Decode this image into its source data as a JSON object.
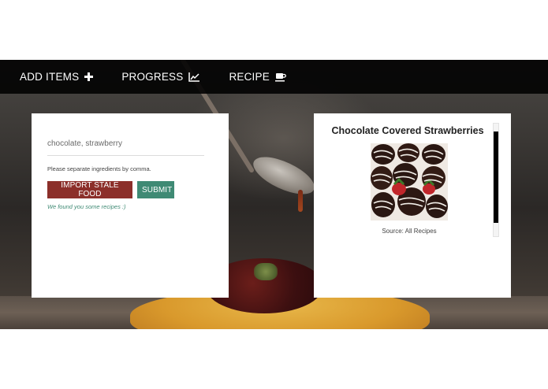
{
  "nav": {
    "items": [
      {
        "label": "ADD ITEMS",
        "icon": "plus-icon"
      },
      {
        "label": "PROGRESS",
        "icon": "line-chart-icon"
      },
      {
        "label": "RECIPE",
        "icon": "coffee-cup-icon"
      }
    ]
  },
  "form": {
    "ingredients_value": "chocolate, strawberry",
    "hint": "Please separate ingredients by comma.",
    "import_label": "IMPORT STALE FOOD",
    "submit_label": "SUBMIT",
    "result_message": "We found you some recipes :)"
  },
  "recipe": {
    "title": "Chocolate Covered Strawberries",
    "source": "Source: All Recipes"
  },
  "colors": {
    "import_button": "#8c2f2a",
    "submit_button": "#3f8a74",
    "navbar": "#000000"
  }
}
